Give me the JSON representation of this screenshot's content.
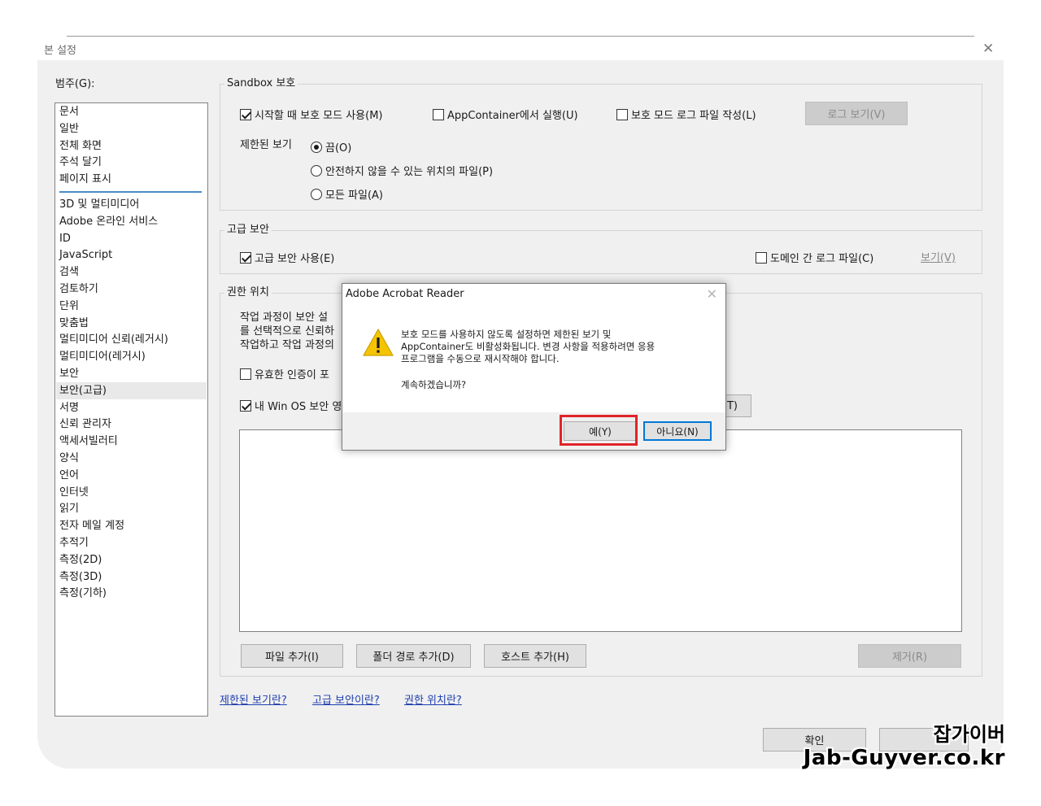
{
  "window": {
    "title": "본 설정",
    "close_glyph": "✕"
  },
  "categories": {
    "label": "범주(G):",
    "group1": [
      "문서",
      "일반",
      "전체 화면",
      "주석 달기",
      "페이지 표시"
    ],
    "group2": [
      "3D 및 멀티미디어",
      "Adobe 온라인 서비스",
      "ID",
      "JavaScript",
      "검색",
      "검토하기",
      "단위",
      "맞춤법",
      "멀티미디어 신뢰(레거시)",
      "멀티미디어(레거시)",
      "보안",
      "보안(고급)",
      "서명",
      "신뢰 관리자",
      "액세서빌러티",
      "양식",
      "언어",
      "인터넷",
      "읽기",
      "전자 메일 계정",
      "추적기",
      "측정(2D)",
      "측정(3D)",
      "측정(기하)"
    ],
    "selected": "보안(고급)"
  },
  "sandbox": {
    "title": "Sandbox 보호",
    "protected_mode": {
      "label": "시작할 때 보호 모드 사용(M)",
      "checked": true
    },
    "appcontainer": {
      "label": "AppContainer에서 실행(U)",
      "checked": false
    },
    "log_file": {
      "label": "보호 모드 로그 파일 작성(L)",
      "checked": false
    },
    "view_log_button": "로그 보기(V)",
    "restricted_view_label": "제한된 보기",
    "radio_off": "끔(O)",
    "radio_unsafe": "안전하지 않을 수 있는 위치의 파일(P)",
    "radio_all": "모든 파일(A)"
  },
  "enhanced": {
    "title": "고급 보안",
    "enable": {
      "label": "고급 보안 사용(E)",
      "checked": true
    },
    "cross_domain": {
      "label": "도메인 간 로그 파일(C)",
      "checked": false
    },
    "view_link": "보기(V)"
  },
  "privileged": {
    "title": "권한 위치",
    "desc_lines": [
      "작업 과정이 보안 설",
      "를 선택적으로 신뢰하",
      "작업하고 작업 과정의"
    ],
    "valid_cert": {
      "label": "유효한 인증이 포",
      "checked": false
    },
    "win_os": {
      "label": "내 Win OS 보안 영",
      "checked": true
    },
    "partial_button": "T)",
    "add_file": "파일 추가(I)",
    "add_folder": "폴더 경로 추가(D)",
    "add_host": "호스트 추가(H)",
    "remove": "제거(R)"
  },
  "links": {
    "restricted_view": "제한된 보기란?",
    "enhanced_security": "고급 보안이란?",
    "privileged_locations": "권한 위치란?"
  },
  "footer": {
    "ok": "확인"
  },
  "dialog": {
    "title": "Adobe Acrobat Reader",
    "close_glyph": "✕",
    "message_lines": [
      "보호 모드를 사용하지 않도록 설정하면 제한된 보기 및",
      "AppContainer도 비활성화됩니다. 변경 사항을 적용하려면 응용",
      "프로그램을 수동으로 재시작해야 합니다."
    ],
    "question": "계속하겠습니까?",
    "yes": "예(Y)",
    "no": "아니요(N)"
  },
  "watermark": {
    "line1": "잡가이버",
    "line2": "Jab-Guyver.co.kr"
  },
  "colors": {
    "highlight": "#e0232b",
    "link": "#1f3fb0",
    "accent": "#0078d7",
    "warning": "#f5c400"
  }
}
